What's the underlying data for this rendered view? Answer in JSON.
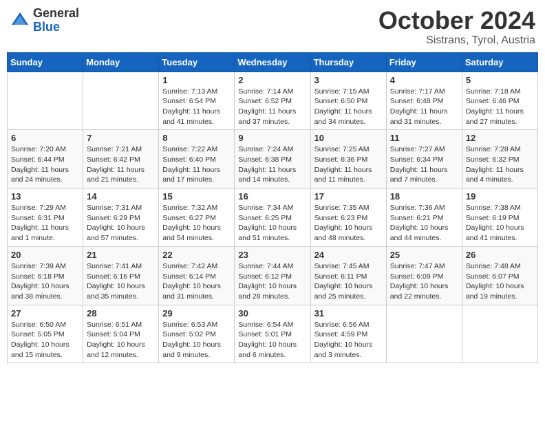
{
  "header": {
    "logo_general": "General",
    "logo_blue": "Blue",
    "month_title": "October 2024",
    "location": "Sistrans, Tyrol, Austria"
  },
  "days_of_week": [
    "Sunday",
    "Monday",
    "Tuesday",
    "Wednesday",
    "Thursday",
    "Friday",
    "Saturday"
  ],
  "weeks": [
    [
      {
        "day": "",
        "sunrise": "",
        "sunset": "",
        "daylight": ""
      },
      {
        "day": "",
        "sunrise": "",
        "sunset": "",
        "daylight": ""
      },
      {
        "day": "1",
        "sunrise": "Sunrise: 7:13 AM",
        "sunset": "Sunset: 6:54 PM",
        "daylight": "Daylight: 11 hours and 41 minutes."
      },
      {
        "day": "2",
        "sunrise": "Sunrise: 7:14 AM",
        "sunset": "Sunset: 6:52 PM",
        "daylight": "Daylight: 11 hours and 37 minutes."
      },
      {
        "day": "3",
        "sunrise": "Sunrise: 7:15 AM",
        "sunset": "Sunset: 6:50 PM",
        "daylight": "Daylight: 11 hours and 34 minutes."
      },
      {
        "day": "4",
        "sunrise": "Sunrise: 7:17 AM",
        "sunset": "Sunset: 6:48 PM",
        "daylight": "Daylight: 11 hours and 31 minutes."
      },
      {
        "day": "5",
        "sunrise": "Sunrise: 7:18 AM",
        "sunset": "Sunset: 6:46 PM",
        "daylight": "Daylight: 11 hours and 27 minutes."
      }
    ],
    [
      {
        "day": "6",
        "sunrise": "Sunrise: 7:20 AM",
        "sunset": "Sunset: 6:44 PM",
        "daylight": "Daylight: 11 hours and 24 minutes."
      },
      {
        "day": "7",
        "sunrise": "Sunrise: 7:21 AM",
        "sunset": "Sunset: 6:42 PM",
        "daylight": "Daylight: 11 hours and 21 minutes."
      },
      {
        "day": "8",
        "sunrise": "Sunrise: 7:22 AM",
        "sunset": "Sunset: 6:40 PM",
        "daylight": "Daylight: 11 hours and 17 minutes."
      },
      {
        "day": "9",
        "sunrise": "Sunrise: 7:24 AM",
        "sunset": "Sunset: 6:38 PM",
        "daylight": "Daylight: 11 hours and 14 minutes."
      },
      {
        "day": "10",
        "sunrise": "Sunrise: 7:25 AM",
        "sunset": "Sunset: 6:36 PM",
        "daylight": "Daylight: 11 hours and 11 minutes."
      },
      {
        "day": "11",
        "sunrise": "Sunrise: 7:27 AM",
        "sunset": "Sunset: 6:34 PM",
        "daylight": "Daylight: 11 hours and 7 minutes."
      },
      {
        "day": "12",
        "sunrise": "Sunrise: 7:28 AM",
        "sunset": "Sunset: 6:32 PM",
        "daylight": "Daylight: 11 hours and 4 minutes."
      }
    ],
    [
      {
        "day": "13",
        "sunrise": "Sunrise: 7:29 AM",
        "sunset": "Sunset: 6:31 PM",
        "daylight": "Daylight: 11 hours and 1 minute."
      },
      {
        "day": "14",
        "sunrise": "Sunrise: 7:31 AM",
        "sunset": "Sunset: 6:29 PM",
        "daylight": "Daylight: 10 hours and 57 minutes."
      },
      {
        "day": "15",
        "sunrise": "Sunrise: 7:32 AM",
        "sunset": "Sunset: 6:27 PM",
        "daylight": "Daylight: 10 hours and 54 minutes."
      },
      {
        "day": "16",
        "sunrise": "Sunrise: 7:34 AM",
        "sunset": "Sunset: 6:25 PM",
        "daylight": "Daylight: 10 hours and 51 minutes."
      },
      {
        "day": "17",
        "sunrise": "Sunrise: 7:35 AM",
        "sunset": "Sunset: 6:23 PM",
        "daylight": "Daylight: 10 hours and 48 minutes."
      },
      {
        "day": "18",
        "sunrise": "Sunrise: 7:36 AM",
        "sunset": "Sunset: 6:21 PM",
        "daylight": "Daylight: 10 hours and 44 minutes."
      },
      {
        "day": "19",
        "sunrise": "Sunrise: 7:38 AM",
        "sunset": "Sunset: 6:19 PM",
        "daylight": "Daylight: 10 hours and 41 minutes."
      }
    ],
    [
      {
        "day": "20",
        "sunrise": "Sunrise: 7:39 AM",
        "sunset": "Sunset: 6:18 PM",
        "daylight": "Daylight: 10 hours and 38 minutes."
      },
      {
        "day": "21",
        "sunrise": "Sunrise: 7:41 AM",
        "sunset": "Sunset: 6:16 PM",
        "daylight": "Daylight: 10 hours and 35 minutes."
      },
      {
        "day": "22",
        "sunrise": "Sunrise: 7:42 AM",
        "sunset": "Sunset: 6:14 PM",
        "daylight": "Daylight: 10 hours and 31 minutes."
      },
      {
        "day": "23",
        "sunrise": "Sunrise: 7:44 AM",
        "sunset": "Sunset: 6:12 PM",
        "daylight": "Daylight: 10 hours and 28 minutes."
      },
      {
        "day": "24",
        "sunrise": "Sunrise: 7:45 AM",
        "sunset": "Sunset: 6:11 PM",
        "daylight": "Daylight: 10 hours and 25 minutes."
      },
      {
        "day": "25",
        "sunrise": "Sunrise: 7:47 AM",
        "sunset": "Sunset: 6:09 PM",
        "daylight": "Daylight: 10 hours and 22 minutes."
      },
      {
        "day": "26",
        "sunrise": "Sunrise: 7:48 AM",
        "sunset": "Sunset: 6:07 PM",
        "daylight": "Daylight: 10 hours and 19 minutes."
      }
    ],
    [
      {
        "day": "27",
        "sunrise": "Sunrise: 6:50 AM",
        "sunset": "Sunset: 5:05 PM",
        "daylight": "Daylight: 10 hours and 15 minutes."
      },
      {
        "day": "28",
        "sunrise": "Sunrise: 6:51 AM",
        "sunset": "Sunset: 5:04 PM",
        "daylight": "Daylight: 10 hours and 12 minutes."
      },
      {
        "day": "29",
        "sunrise": "Sunrise: 6:53 AM",
        "sunset": "Sunset: 5:02 PM",
        "daylight": "Daylight: 10 hours and 9 minutes."
      },
      {
        "day": "30",
        "sunrise": "Sunrise: 6:54 AM",
        "sunset": "Sunset: 5:01 PM",
        "daylight": "Daylight: 10 hours and 6 minutes."
      },
      {
        "day": "31",
        "sunrise": "Sunrise: 6:56 AM",
        "sunset": "Sunset: 4:59 PM",
        "daylight": "Daylight: 10 hours and 3 minutes."
      },
      {
        "day": "",
        "sunrise": "",
        "sunset": "",
        "daylight": ""
      },
      {
        "day": "",
        "sunrise": "",
        "sunset": "",
        "daylight": ""
      }
    ]
  ]
}
